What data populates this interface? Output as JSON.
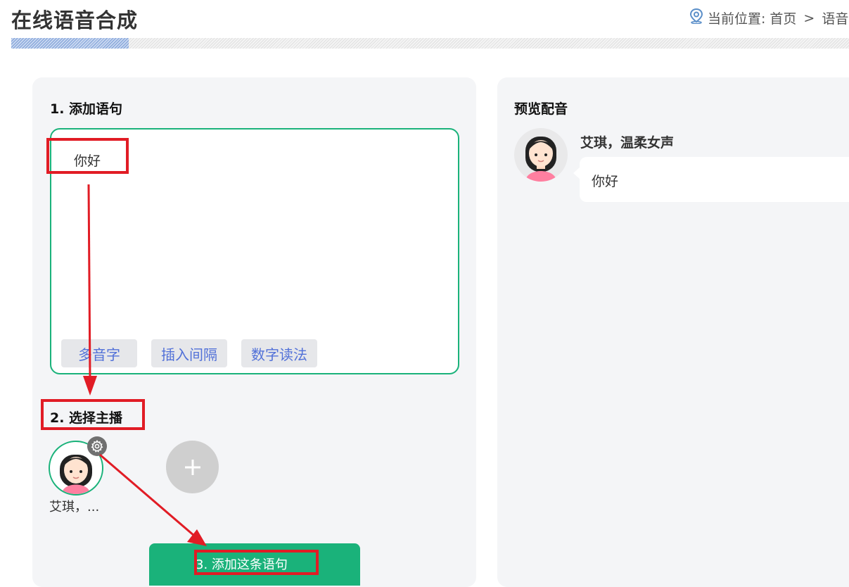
{
  "header": {
    "title": "在线语音合成",
    "breadcrumb": {
      "prefix": "当前位置:",
      "home": "首页",
      "separator": ">",
      "current": "语音"
    },
    "progress_fraction": 0.14
  },
  "editor": {
    "heading": "1. 添加语句",
    "text": "你好",
    "tools": [
      "多音字",
      "插入间隔",
      "数字读法"
    ]
  },
  "anchor_section": {
    "heading": "2. 选择主播",
    "selected_anchor_name": "艾琪，..."
  },
  "actions": {
    "add_sentence_label": "3. 添加这条语句"
  },
  "preview": {
    "heading": "预览配音",
    "speaker": "艾琪，温柔女声",
    "text": "你好"
  },
  "colors": {
    "accent_green": "#1ab27a",
    "annotation_red": "#e11c25",
    "tool_text_blue": "#5271d8",
    "panel_bg": "#f4f5f7"
  },
  "icons": {
    "location": "location-pin-icon",
    "gear": "gear-icon",
    "add": "plus-icon"
  }
}
